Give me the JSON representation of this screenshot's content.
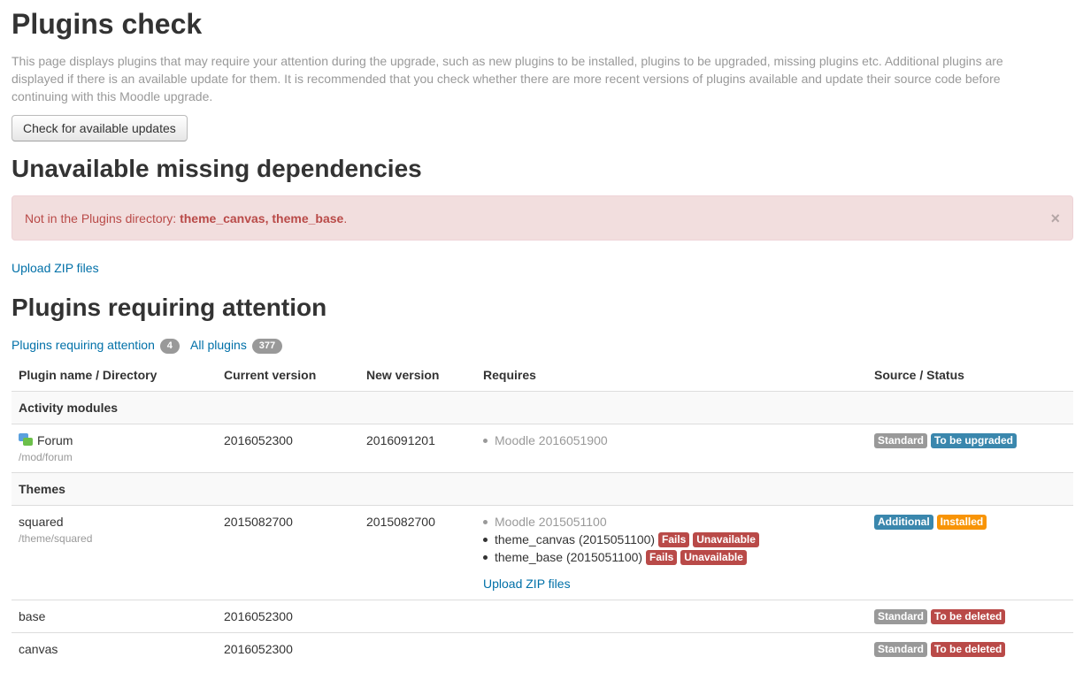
{
  "page": {
    "title": "Plugins check",
    "intro": "This page displays plugins that may require your attention during the upgrade, such as new plugins to be installed, plugins to be upgraded, missing plugins etc. Additional plugins are displayed if there is an available update for them. It is recommended that you check whether there are more recent versions of plugins available and update their source code before continuing with this Moodle upgrade.",
    "check_button": "Check for available updates"
  },
  "missing": {
    "heading": "Unavailable missing dependencies",
    "alert_prefix": "Not in the Plugins directory: ",
    "alert_items": "theme_canvas, theme_base",
    "alert_suffix": ".",
    "close": "×",
    "upload_link": "Upload ZIP files"
  },
  "attention": {
    "heading": "Plugins requiring attention",
    "tabs": [
      {
        "label": "Plugins requiring attention",
        "count": "4"
      },
      {
        "label": "All plugins",
        "count": "377"
      }
    ],
    "columns": [
      "Plugin name / Directory",
      "Current version",
      "New version",
      "Requires",
      "Source / Status"
    ],
    "sections": {
      "activity": "Activity modules",
      "themes": "Themes"
    },
    "rows": {
      "forum": {
        "name": "Forum",
        "dir": "/mod/forum",
        "current": "2016052300",
        "new": "2016091201",
        "requires": [
          "Moodle 2016051900"
        ],
        "source": "Standard",
        "status": "To be upgraded"
      },
      "squared": {
        "name": "squared",
        "dir": "/theme/squared",
        "current": "2015082700",
        "new": "2015082700",
        "req_ok": "Moodle 2015051100",
        "req_fail": [
          {
            "text": "theme_canvas (2015051100)",
            "fails": "Fails",
            "status": "Unavailable"
          },
          {
            "text": "theme_base (2015051100)",
            "fails": "Fails",
            "status": "Unavailable"
          }
        ],
        "upload_link": "Upload ZIP files",
        "source": "Additional",
        "status": "Installed"
      },
      "base": {
        "name": "base",
        "current": "2016052300",
        "source": "Standard",
        "status": "To be deleted"
      },
      "canvas": {
        "name": "canvas",
        "current": "2016052300",
        "source": "Standard",
        "status": "To be deleted"
      }
    }
  },
  "colors": {
    "link": "#0070a8",
    "alert_bg": "#f2dede",
    "alert_text": "#b94a48",
    "label_grey": "#999999",
    "label_blue": "#3a87ad",
    "label_red": "#b94a48",
    "label_orange": "#f89406"
  }
}
